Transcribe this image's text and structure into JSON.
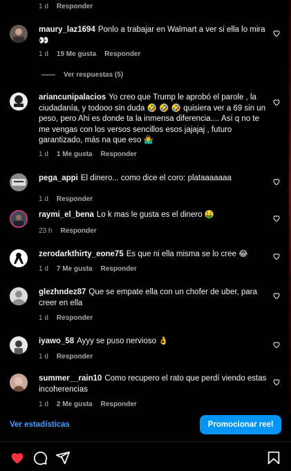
{
  "colors": {
    "accent": "#0095f6",
    "like_red": "#ff3040",
    "muted": "#a8a8a8"
  },
  "top_meta": {
    "time": "1 d",
    "reply": "Responder"
  },
  "view_replies": "Ver respuestas (5)",
  "comments": [
    {
      "user": "maury_laz1694",
      "text": "Ponlo a trabajar en Walmart a ver si ella lo mira 👀",
      "time": "1 d",
      "likes": "19 Me gusta",
      "reply": "Responder"
    },
    {
      "user": "ariancunipalacios",
      "text": "Yo creo que Trump le aprobó el parole , la ciudadanía, y todooo sin duda 🤣 🤣 🤣 quisiera ver a 69 sin un peso, pero Ahi es donde ta la inmensa diferencia.... Así q no te me vengas con los versos sencillos esos jajajaj , futuro garantizado, más na que eso 🤷‍♂️",
      "time": "1 d",
      "likes": "1 Me gusta",
      "reply": "Responder"
    },
    {
      "user": "pega_appi",
      "text": "El dinero... como dice el coro: plataaaaaaa",
      "time": "1 d",
      "likes": "",
      "reply": "Responder"
    },
    {
      "user": "raymi_el_bena",
      "text": "Lo k mas le gusta es el dinero 🤑",
      "time": "23 h",
      "likes": "",
      "reply": "Responder"
    },
    {
      "user": "zerodarkthirty_eone75",
      "text": "Es que ni ella misma se lo cree 😂",
      "time": "1 d",
      "likes": "7 Me gusta",
      "reply": "Responder"
    },
    {
      "user": "glezhndez87",
      "text": "Que se empate ella con un chofer de uber, para creer en ella",
      "time": "1 d",
      "likes": "",
      "reply": "Responder"
    },
    {
      "user": "iyawo_58",
      "text": "Ayyy se puso nervioso 👌",
      "time": "1 d",
      "likes": "",
      "reply": "Responder"
    },
    {
      "user": "summer__rain10",
      "text": "Como recupero el rato que perdí viendo estas incoherencias",
      "time": "1 d",
      "likes": "2 Me gusta",
      "reply": "Responder"
    }
  ],
  "footer": {
    "stats_label": "Ver estadísticas",
    "promote_label": "Promocionar reel"
  },
  "action_icons": [
    "heart-filled-icon",
    "comment-icon",
    "share-icon",
    "bookmark-icon"
  ]
}
